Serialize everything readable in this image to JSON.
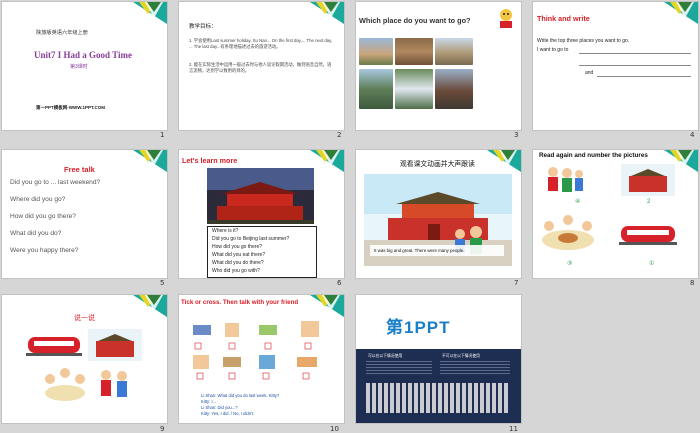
{
  "slides": [
    {
      "number": "1",
      "book": "陕旅版英语六年级上册",
      "title": "Unit7 I Had a Good Time",
      "lesson": "第3课时",
      "footer": "第一PPT模板网-WWW.1PPT.COM"
    },
    {
      "number": "2",
      "heading": "教学目标：",
      "points": [
        "1. 学会使用Last summer holiday, Su Nan... On the first day,... The next day, ... The last day...有条理地描述过去的旅游活动。",
        "2. 能在实际生活中运用一般过去时与他人谈论假期活动，做到语音自然，语言流畅，达到学以致用的目的。"
      ]
    },
    {
      "number": "3",
      "heading": "Which place do you want to go?"
    },
    {
      "number": "4",
      "heading": "Think and write",
      "line1": "Write the top three places you want to go.",
      "line2": "I want to go to",
      "line3": "and"
    },
    {
      "number": "5",
      "heading": "Free talk",
      "questions": [
        "Did you go to ... last weekend?",
        "Where did you go?",
        "How did you go there?",
        "What did you do?",
        "Were you happy there?"
      ]
    },
    {
      "number": "6",
      "heading": "Let's learn more",
      "questions": [
        "Where is it?",
        "Did you go to Beijing last summer?",
        "How did you go there?",
        "What did you eat there?",
        "What did you do there?",
        "Who did you go with?"
      ]
    },
    {
      "number": "7",
      "heading": "观看课文动画并大声跟读",
      "caption": "It was big and great. There were many people."
    },
    {
      "number": "8",
      "heading": "Read again and number the pictures",
      "labels": [
        "④",
        "2",
        "③",
        "①"
      ]
    },
    {
      "number": "9",
      "heading": "说一说"
    },
    {
      "number": "10",
      "heading": "Tick or cross. Then talk with your friend",
      "dialog": [
        "Li Shan: What did you do last week, Kitty?",
        "Kitty: I...",
        "Li Shan: Did you...?",
        "Kitty: Yes, I did. / No, I didn't."
      ]
    },
    {
      "number": "11",
      "logo": "第1PPT",
      "col1_title": "可以在以下情况使用",
      "col2_title": "不可以在以下情况使用"
    }
  ],
  "colors": {
    "slide_bg": "#ffffff",
    "canvas_bg": "#d6d6d6",
    "accent_red": "#d6202a",
    "accent_purple": "#8a3c9c",
    "accent_blue": "#1a4fa0",
    "teal": "#1aa99b",
    "yellow": "#e5d624"
  }
}
